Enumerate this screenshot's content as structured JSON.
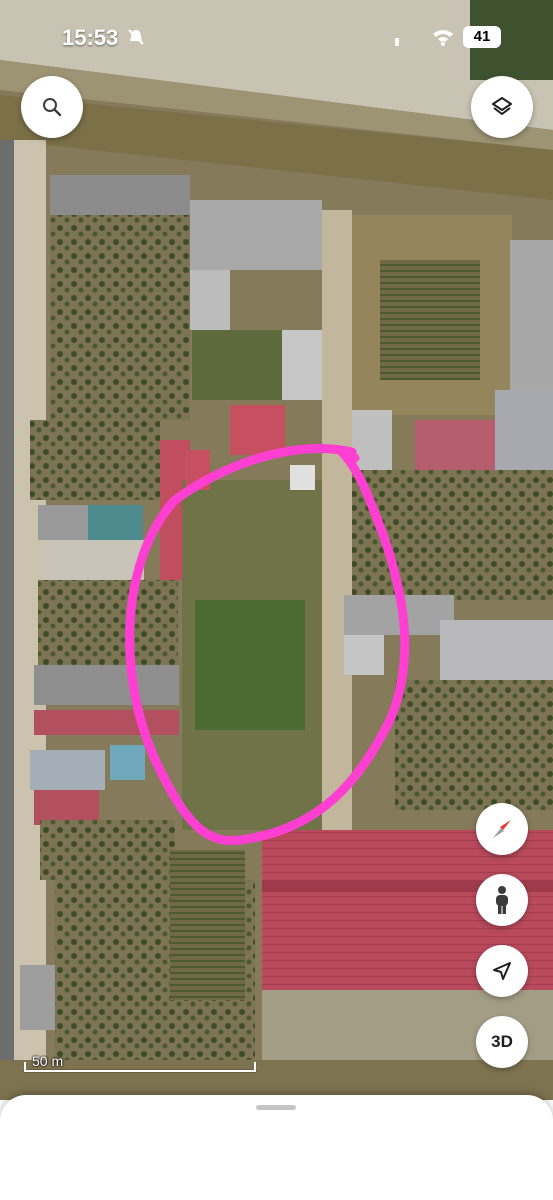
{
  "status_bar": {
    "time": "15:53",
    "battery": "41"
  },
  "map": {
    "view": "satellite",
    "scale_label": "50 m",
    "highlight_color": "#ff3fd2"
  },
  "controls": {
    "search_icon": "search-icon",
    "layers_icon": "layers-icon",
    "compass_icon": "compass-icon",
    "street_view_icon": "pegman-icon",
    "location_icon": "navigation-arrow-icon",
    "three_d_label": "3D"
  }
}
